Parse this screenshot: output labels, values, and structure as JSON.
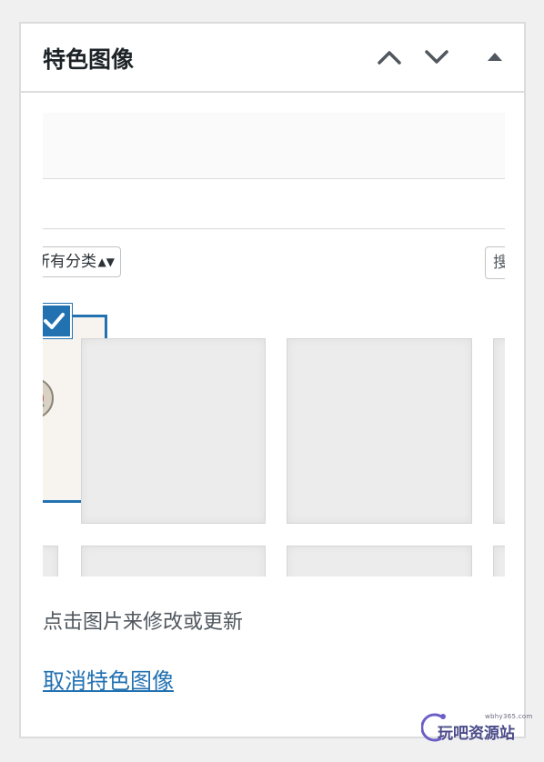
{
  "panel": {
    "title": "特色图像",
    "controls": {
      "move_up_icon": "chevron-up-icon",
      "move_down_icon": "chevron-down-icon",
      "toggle_icon": "triangle-up-icon"
    }
  },
  "media_preview": {
    "filter_label": "所有分类",
    "filter_visible_text": "所有分类",
    "search_label": "搜"
  },
  "help_text": "点击图片来修改或更新",
  "remove_link": "取消特色图像",
  "watermark": {
    "domain": "wbhy365.com",
    "name": "玩吧资源站"
  },
  "colors": {
    "accent": "#2271b1",
    "border": "#dcdcde",
    "text": "#1d2327",
    "muted": "#50575e"
  }
}
